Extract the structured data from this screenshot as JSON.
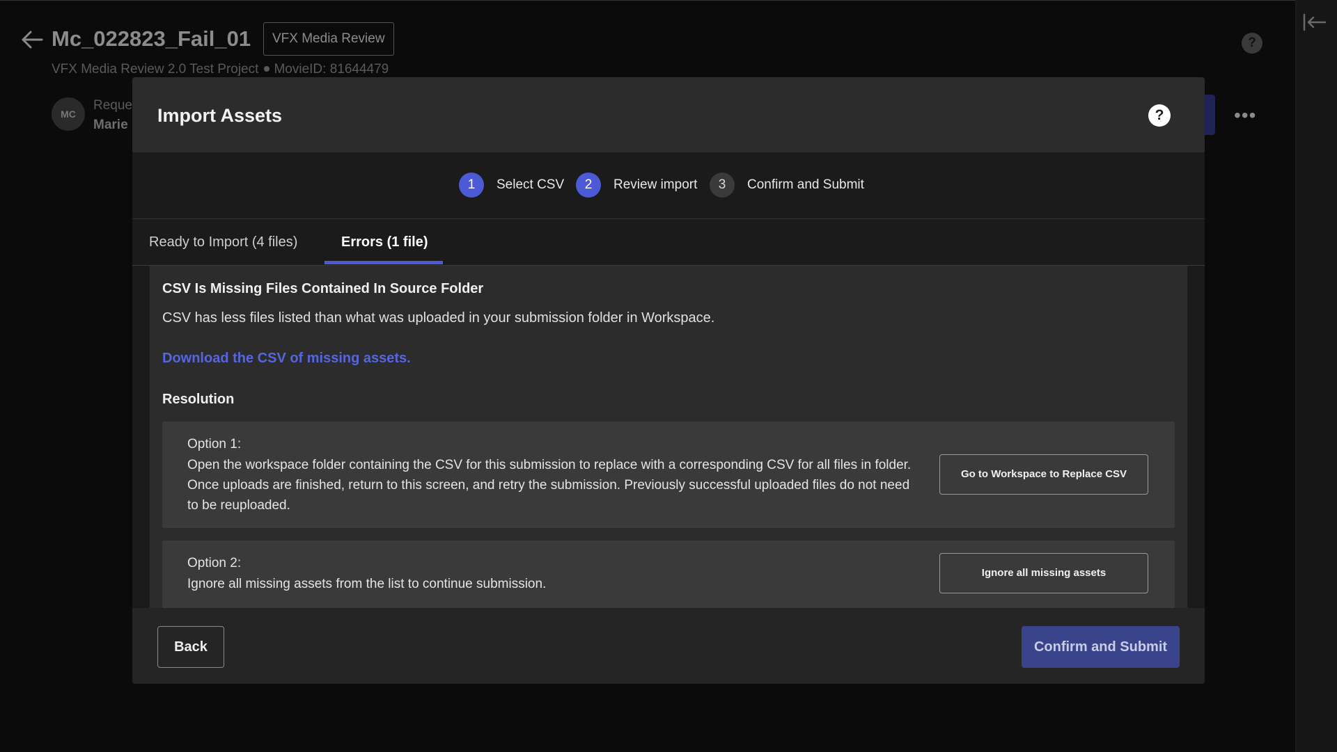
{
  "background": {
    "page_title": "Mc_022823_Fail_01",
    "badge": "VFX Media Review",
    "subtitle_project": "VFX Media Review 2.0 Test Project",
    "subtitle_movie": "MovieID: 81644479",
    "avatar_initials": "MC",
    "requester_label": "Reque",
    "requester_name": "Marie",
    "help_glyph": "?",
    "more_glyph": "•••"
  },
  "modal": {
    "title": "Import Assets",
    "help_glyph": "?",
    "steps": [
      {
        "number": "1",
        "label": "Select CSV",
        "state": "complete"
      },
      {
        "number": "2",
        "label": "Review import",
        "state": "current"
      },
      {
        "number": "3",
        "label": "Confirm and Submit",
        "state": "upcoming"
      }
    ],
    "tabs": [
      {
        "label": "Ready to Import (4 files)",
        "active": false
      },
      {
        "label": "Errors (1 file)",
        "active": true
      }
    ],
    "error": {
      "title": "CSV Is Missing Files Contained In Source Folder",
      "description": "CSV has less files listed than what was uploaded in your submission folder in Workspace.",
      "link": "Download the CSV of missing assets.",
      "resolution_heading": "Resolution",
      "options": [
        {
          "label": "Option 1:",
          "text": "Open the workspace folder containing the CSV for this submission to replace with a corresponding CSV for all files in folder. Once uploads are finished, return to this screen, and retry the submission. Previously successful uploaded files do not need to be reuploaded.",
          "button": "Go to Workspace to Replace CSV"
        },
        {
          "label": "Option 2:",
          "text": "Ignore all missing assets from the list to continue submission.",
          "button": "Ignore all missing assets"
        }
      ]
    },
    "footer": {
      "back": "Back",
      "confirm": "Confirm and Submit"
    }
  },
  "colors": {
    "accent": "#4d5ad6",
    "link": "#5566e0",
    "confirm_button": "#3a448a"
  },
  "icons": {
    "back": "arrow-left-icon",
    "collapse": "collapse-panel-icon",
    "help": "help-circle-icon",
    "more": "more-horizontal-icon"
  }
}
